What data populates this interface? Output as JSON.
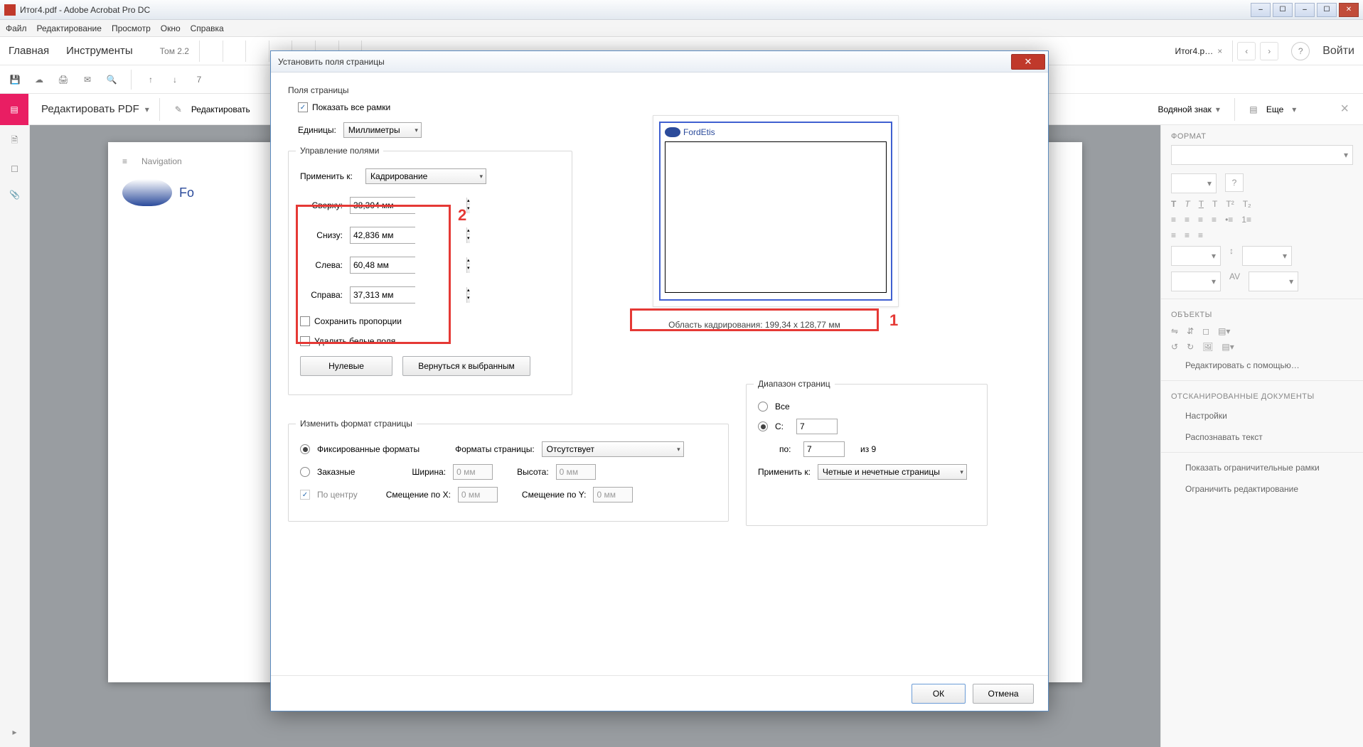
{
  "titlebar": {
    "title": "Итог4.pdf - Adobe Acrobat Pro DC"
  },
  "menubar": {
    "file": "Файл",
    "edit": "Редактирование",
    "view": "Просмотр",
    "window": "Окно",
    "help": "Справка"
  },
  "tabbar": {
    "home": "Главная",
    "tools": "Инструменты",
    "tab1": "Том 2.2",
    "tab_active": "Итог4.p…",
    "login": "Войти"
  },
  "editbar": {
    "label": "Редактировать PDF",
    "btn_edit": "Редактировать",
    "btn_watermark": "Водяной знак",
    "btn_more": "Еще"
  },
  "doc": {
    "nav": "Navigation",
    "brand": "FordEtis"
  },
  "rightpanel": {
    "format": "ФОРМАТ",
    "objects": "ОБЪЕКТЫ",
    "edit_with": "Редактировать с помощью…",
    "scanned": "ОТСКАНИРОВАННЫЕ ДОКУМЕНТЫ",
    "settings": "Настройки",
    "ocr": "Распознавать текст",
    "show_bounds": "Показать ограничительные рамки",
    "restrict_edit": "Ограничить редактирование"
  },
  "dialog": {
    "title": "Установить поля страницы",
    "section_fields": "Поля страницы",
    "show_frames": "Показать все рамки",
    "units_label": "Единицы:",
    "units_value": "Миллиметры",
    "manage_fields": "Управление полями",
    "apply_to": "Применить к:",
    "apply_value": "Кадрирование",
    "top_label": "Сверху:",
    "top_val": "38,304 мм",
    "bottom_label": "Снизу:",
    "bottom_val": "42,836 мм",
    "left_label": "Слева:",
    "left_val": "60,48 мм",
    "right_label": "Справа:",
    "right_val": "37,313 мм",
    "keep_prop": "Сохранить пропорции",
    "remove_white": "Удалить белые поля",
    "zero_btn": "Нулевые",
    "revert_btn": "Вернуться к выбранным",
    "crop_area": "Область кадрирования: 199,34 x 128,77 мм",
    "change_format": "Изменить формат страницы",
    "fixed_formats": "Фиксированные форматы",
    "page_formats": "Форматы страницы:",
    "page_format_val": "Отсутствует",
    "custom": "Заказные",
    "width": "Ширина:",
    "width_val": "0 мм",
    "height": "Высота:",
    "height_val": "0 мм",
    "center_label": "По центру",
    "offset_x": "Смещение по X:",
    "offset_x_val": "0 мм",
    "offset_y": "Смещение по Y:",
    "offset_y_val": "0 мм",
    "page_range": "Диапазон страниц",
    "all": "Все",
    "from": "С:",
    "from_val": "7",
    "to": "по:",
    "to_val": "7",
    "of": "из 9",
    "range_apply": "Применить к:",
    "range_apply_val": "Четные и нечетные страницы",
    "ok": "ОК",
    "cancel": "Отмена",
    "annot1": "1",
    "annot2": "2",
    "preview_brand": "FordEtis"
  }
}
